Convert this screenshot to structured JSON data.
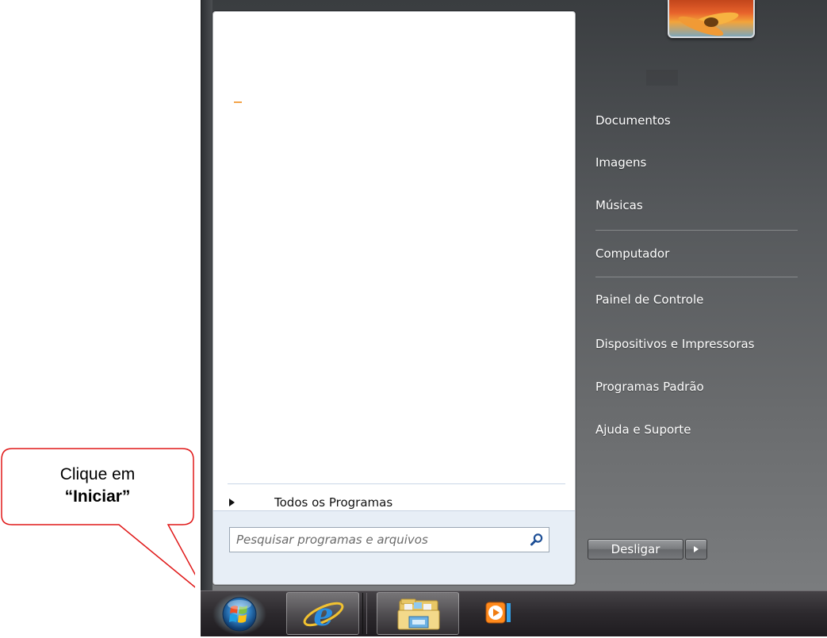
{
  "start_menu": {
    "right_items": [
      {
        "label": "Documentos"
      },
      {
        "label": "Imagens"
      },
      {
        "label": "Músicas"
      },
      {
        "label": "Computador"
      },
      {
        "label": "Painel de Controle"
      },
      {
        "label": "Dispositivos e Impressoras"
      },
      {
        "label": "Programas Padrão"
      },
      {
        "label": "Ajuda e Suporte"
      }
    ],
    "all_programs_label": "Todos os Programas",
    "search_placeholder": "Pesquisar programas e arquivos",
    "shutdown_label": "Desligar"
  },
  "taskbar": {
    "items": [
      {
        "icon": "windows-start-orb-icon"
      },
      {
        "icon": "internet-explorer-icon"
      },
      {
        "icon": "windows-explorer-folder-icon"
      },
      {
        "icon": "media-player-icon"
      }
    ]
  },
  "callout": {
    "line1": "Clique em",
    "line2": "“Iniciar”"
  }
}
